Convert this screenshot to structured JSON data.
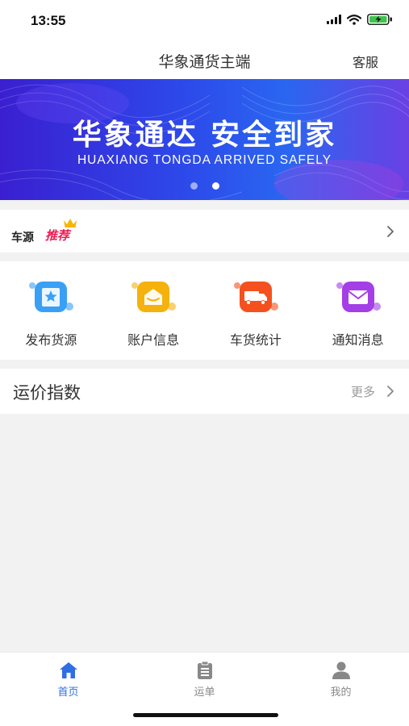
{
  "status_bar": {
    "time": "13:55",
    "icons": [
      "signal-icon",
      "wifi-icon",
      "battery-charging-icon"
    ]
  },
  "nav": {
    "title": "华象通货主端",
    "service": "客服"
  },
  "banner": {
    "title": "华象通达 安全到家",
    "subtitle": "HUAXIANG TONGDA ARRIVED SAFELY",
    "slides": 2,
    "active_slide": 2
  },
  "recommend": {
    "label": "车源",
    "badge": "推荐",
    "icon": "crown-icon"
  },
  "grid": [
    {
      "label": "发布货源",
      "icon": "publish-star-icon",
      "color": "#3aa0f5"
    },
    {
      "label": "账户信息",
      "icon": "wallet-icon",
      "color": "#f5b10c"
    },
    {
      "label": "车货统计",
      "icon": "truck-icon",
      "color": "#f4511e"
    },
    {
      "label": "通知消息",
      "icon": "mail-icon",
      "color": "#a43ee6"
    }
  ],
  "freight": {
    "title": "运价指数",
    "more": "更多"
  },
  "tabbar": {
    "tabs": [
      {
        "label": "首页",
        "icon": "home-icon",
        "active": true
      },
      {
        "label": "运单",
        "icon": "clipboard-icon",
        "active": false
      },
      {
        "label": "我的",
        "icon": "user-icon",
        "active": false
      }
    ],
    "active_color": "#2f6fe4",
    "inactive_color": "#888888"
  }
}
